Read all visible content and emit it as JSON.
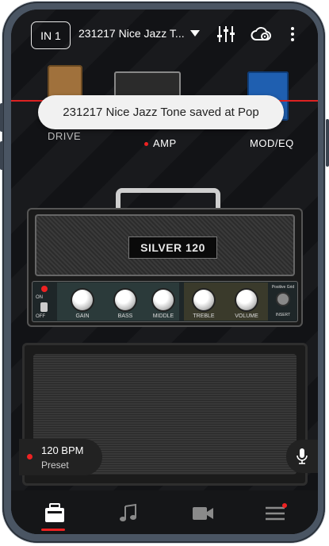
{
  "top": {
    "input_label": "IN 1",
    "preset_name": "231217 Nice Jazz T..."
  },
  "chain": {
    "left_label": "DRIVE",
    "center_label": "AMP",
    "right_label": "MOD/EQ"
  },
  "toast": {
    "message": "231217 Nice Jazz Tone saved at Pop"
  },
  "amp": {
    "name": "SILVER 120",
    "switch_on": "ON",
    "switch_off": "OFF",
    "knobs": [
      "GAIN",
      "BASS",
      "MIDDLE",
      "TREBLE",
      "VOLUME"
    ],
    "extra_label": "Positive Grid",
    "insert_label": "INSERT"
  },
  "tempo": {
    "bpm": "120 BPM",
    "mode": "Preset"
  },
  "icons": [
    "sliders-icon",
    "cloud-sync-icon",
    "more-icon",
    "mic-icon",
    "amp-icon",
    "music-note-icon",
    "video-icon",
    "menu-icon"
  ],
  "colors": {
    "accent": "#dd2222",
    "background": "#121316",
    "frame": "#4a5563"
  }
}
